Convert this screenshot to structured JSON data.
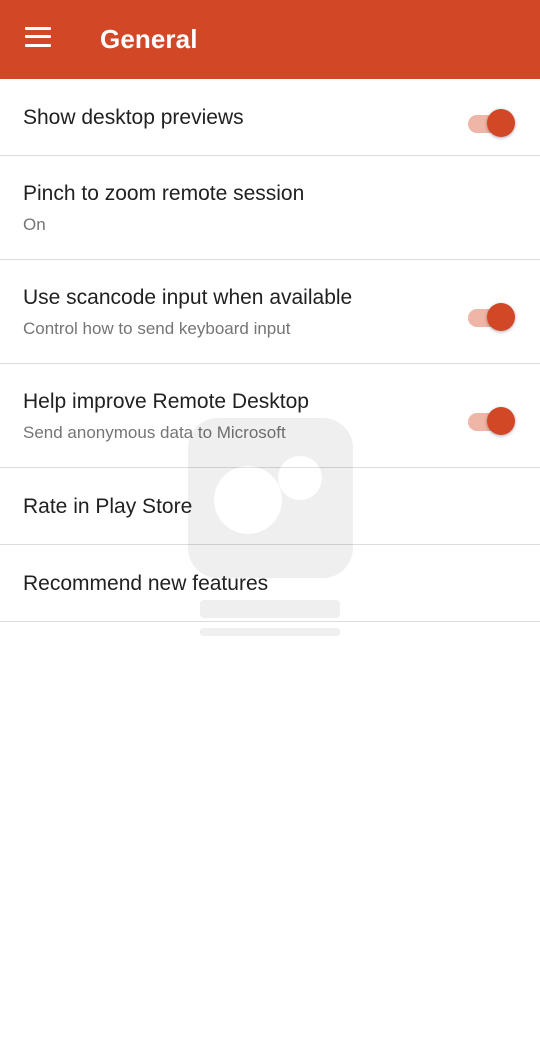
{
  "header": {
    "title": "General",
    "menu_icon": "hamburger-menu-icon",
    "background_color": "#d24726"
  },
  "settings": {
    "show_desktop_previews": {
      "title": "Show desktop previews",
      "toggle_on": true
    },
    "pinch_to_zoom": {
      "title": "Pinch to zoom remote session",
      "subtitle": "On"
    },
    "scancode_input": {
      "title": "Use scancode input when available",
      "subtitle": "Control how to send keyboard input",
      "toggle_on": true
    },
    "help_improve": {
      "title": "Help improve Remote Desktop",
      "subtitle": "Send anonymous data to Microsoft",
      "toggle_on": true
    },
    "rate_play_store": {
      "title": "Rate in Play Store"
    },
    "recommend_features": {
      "title": "Recommend new features"
    }
  },
  "accent_color": "#d24726",
  "watermark": {
    "icon": "watermark-logo-icon"
  }
}
